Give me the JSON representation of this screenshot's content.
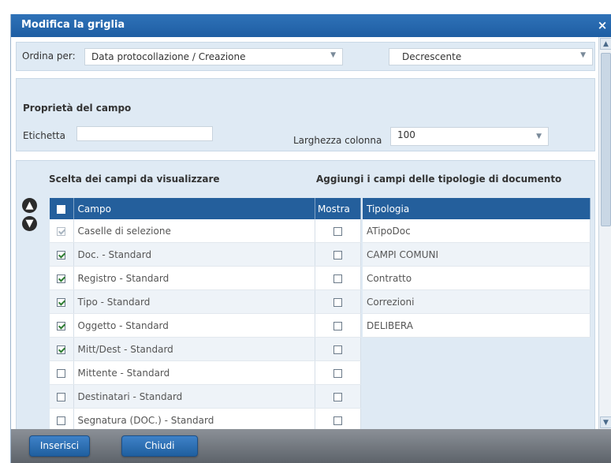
{
  "dialog": {
    "title": "Modifica la griglia",
    "close_glyph": "×"
  },
  "sort": {
    "label": "Ordina per:",
    "field_value": "Data protocollazione / Creazione",
    "direction_value": "Decrescente"
  },
  "properties": {
    "heading": "Proprietà del campo",
    "label_label": "Etichetta",
    "label_value": "",
    "width_label": "Larghezza colonna",
    "width_value": "100"
  },
  "fields": {
    "heading_left": "Scelta dei campi da visualizzare",
    "heading_right": "Aggiungi i campi delle tipologie di documento",
    "columns": {
      "campo": "Campo",
      "mostra": "Mostra",
      "tipologia": "Tipologia"
    },
    "rows": [
      {
        "campo": "Caselle di selezione",
        "checked": true,
        "disabled": true,
        "tipologia": "ATipoDoc"
      },
      {
        "campo": "Doc. - Standard",
        "checked": true,
        "disabled": false,
        "tipologia": "CAMPI COMUNI"
      },
      {
        "campo": "Registro - Standard",
        "checked": true,
        "disabled": false,
        "tipologia": "Contratto"
      },
      {
        "campo": "Tipo - Standard",
        "checked": true,
        "disabled": false,
        "tipologia": "Correzioni"
      },
      {
        "campo": "Oggetto - Standard",
        "checked": true,
        "disabled": false,
        "tipologia": "DELIBERA"
      },
      {
        "campo": "Mitt/Dest - Standard",
        "checked": true,
        "disabled": false,
        "tipologia": ""
      },
      {
        "campo": "Mittente - Standard",
        "checked": false,
        "disabled": false,
        "tipologia": ""
      },
      {
        "campo": "Destinatari - Standard",
        "checked": false,
        "disabled": false,
        "tipologia": ""
      },
      {
        "campo": "Segnatura (DOC.) - Standard",
        "checked": false,
        "disabled": false,
        "tipologia": ""
      }
    ],
    "move_up_icon": "arrow-up",
    "move_down_icon": "arrow-down"
  },
  "footer": {
    "insert_label": "Inserisci",
    "close_label": "Chiudi"
  },
  "colors": {
    "title_bar": "#1e5ea3",
    "panel_bg": "#dfeaf4",
    "grid_header": "#245f9c",
    "footer": "#6b7178"
  }
}
